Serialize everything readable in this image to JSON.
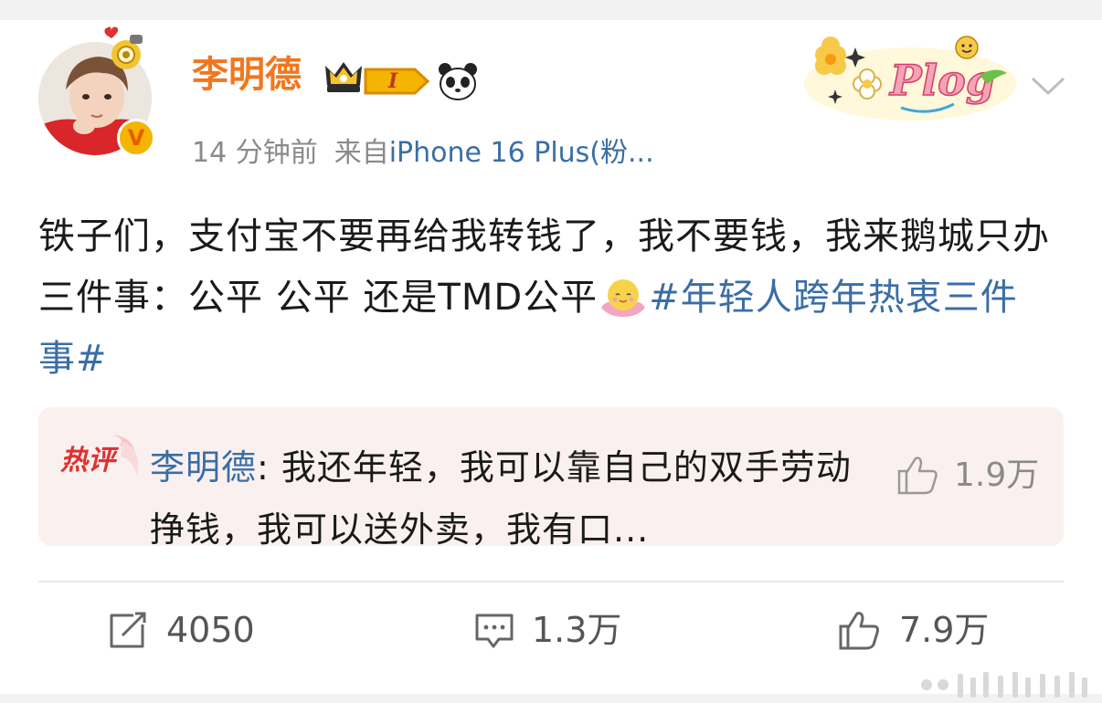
{
  "post": {
    "author_name": "李明德",
    "level_badge": "I",
    "time": "14 分钟前",
    "source_prefix": "来自",
    "source_device": "iPhone 16 Plus(粉...",
    "sticker_text": "Plog",
    "content_main": "铁子们，支付宝不要再给我转钱了，我不要钱，我来鹅城只办三件事：公平 公平 还是TMD公平",
    "content_tag": "#年轻人跨年热衷三件事#"
  },
  "hot_comment": {
    "badge": "热评",
    "author": "李明德",
    "colon": ": ",
    "text": "我还年轻，我可以靠自己的双手劳动挣钱，我可以送外卖，我有口...",
    "likes": "1.9万"
  },
  "actions": {
    "repost_count": "4050",
    "comment_count": "1.3万",
    "like_count": "7.9万"
  },
  "icons": {
    "avatar": "avatar-image",
    "verified": "verified-v-icon",
    "crown": "crown-icon",
    "panda": "panda-icon",
    "plog": "plog-sticker",
    "menu": "chevron-down-icon",
    "hot_like": "thumbs-up-icon",
    "repost": "repost-icon",
    "comment": "comment-icon",
    "like": "thumbs-up-icon"
  },
  "colors": {
    "name": "#f0771f",
    "link": "#3a6ea5",
    "hot_badge": "#e0312f",
    "hot_bg": "#fbf0f0"
  }
}
